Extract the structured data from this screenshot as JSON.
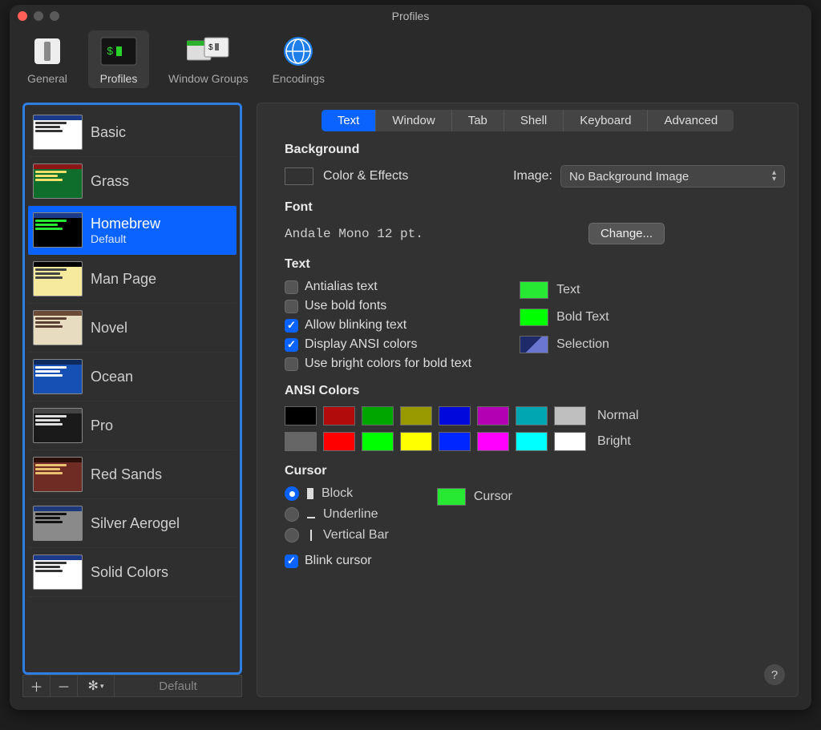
{
  "window": {
    "title": "Profiles"
  },
  "toolbar": {
    "items": [
      {
        "label": "General"
      },
      {
        "label": "Profiles"
      },
      {
        "label": "Window Groups"
      },
      {
        "label": "Encodings"
      }
    ]
  },
  "sidebar": {
    "profiles": [
      {
        "name": "Basic"
      },
      {
        "name": "Grass"
      },
      {
        "name": "Homebrew",
        "subtitle": "Default",
        "selected": true
      },
      {
        "name": "Man Page"
      },
      {
        "name": "Novel"
      },
      {
        "name": "Ocean"
      },
      {
        "name": "Pro"
      },
      {
        "name": "Red Sands"
      },
      {
        "name": "Silver Aerogel"
      },
      {
        "name": "Solid Colors"
      }
    ],
    "footer_default": "Default"
  },
  "tabs": [
    "Text",
    "Window",
    "Tab",
    "Shell",
    "Keyboard",
    "Advanced"
  ],
  "section_background": {
    "heading": "Background",
    "color_effects": "Color & Effects",
    "image_label": "Image:",
    "image_value": "No Background Image",
    "swatch": "#0b0b0b"
  },
  "section_font": {
    "heading": "Font",
    "value": "Andale Mono 12 pt.",
    "change": "Change..."
  },
  "section_text": {
    "heading": "Text",
    "opts": {
      "antialias": "Antialias text",
      "bold": "Use bold fonts",
      "blink": "Allow blinking text",
      "ansi": "Display ANSI colors",
      "bright_bold": "Use bright colors for bold text"
    },
    "checked": {
      "antialias": false,
      "bold": false,
      "blink": true,
      "ansi": true,
      "bright_bold": false
    },
    "colors": {
      "text": {
        "label": "Text",
        "hex": "#27e833"
      },
      "bold": {
        "label": "Bold Text",
        "hex": "#00ff00"
      },
      "sel": {
        "label": "Selection"
      }
    }
  },
  "section_ansi": {
    "heading": "ANSI Colors",
    "labels": {
      "normal": "Normal",
      "bright": "Bright"
    },
    "normal": [
      "#000000",
      "#b10b0b",
      "#00a600",
      "#999900",
      "#0008db",
      "#b200b2",
      "#00a6b2",
      "#bfbfbf"
    ],
    "bright": [
      "#666666",
      "#ff0000",
      "#00ff00",
      "#ffff00",
      "#0026ff",
      "#ff00ff",
      "#00ffff",
      "#ffffff"
    ]
  },
  "section_cursor": {
    "heading": "Cursor",
    "options": {
      "block": "Block",
      "underline": "Underline",
      "vbar": "Vertical Bar"
    },
    "selected": "block",
    "blink_label": "Blink cursor",
    "blink_checked": true,
    "cursor_color_label": "Cursor",
    "cursor_color": "#27e833"
  }
}
